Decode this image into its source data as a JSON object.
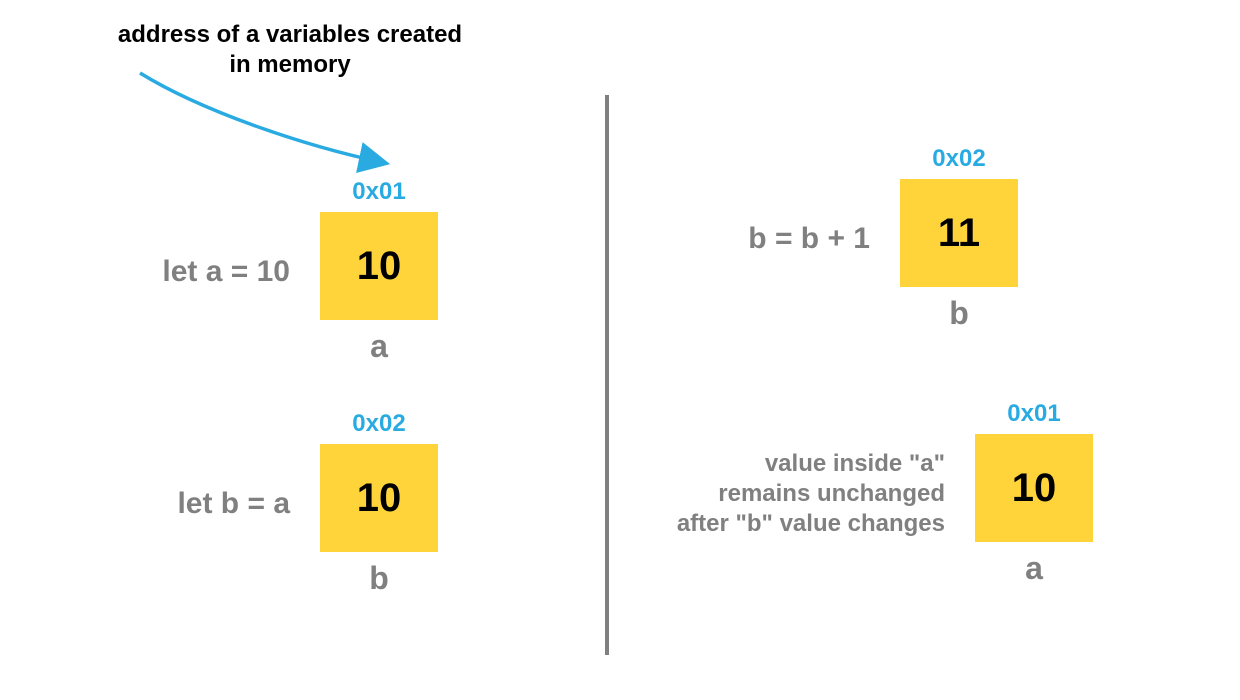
{
  "callout": {
    "line1": "address of a variables created",
    "line2": "in memory"
  },
  "colors": {
    "box": "#ffd43b",
    "addr": "#29abe2",
    "label": "#808080",
    "arrow": "#29abe2"
  },
  "cells": {
    "c1": {
      "label": "let a = 10",
      "addr": "0x01",
      "value": "10",
      "var": "a"
    },
    "c2": {
      "label": "let b = a",
      "addr": "0x02",
      "value": "10",
      "var": "b"
    },
    "c3": {
      "label": "b = b + 1",
      "addr": "0x02",
      "value": "11",
      "var": "b"
    },
    "c4": {
      "label_line1": "value inside \"a\"",
      "label_line2": "remains unchanged",
      "label_line3": "after \"b\" value changes",
      "addr": "0x01",
      "value": "10",
      "var": "a"
    }
  }
}
